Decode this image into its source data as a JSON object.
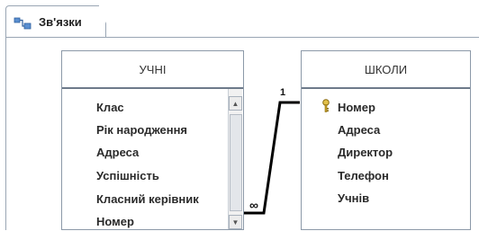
{
  "tab": {
    "label": "Зв'язки",
    "icon": "relationships-icon"
  },
  "tables": {
    "students": {
      "title": "УЧНІ",
      "fields": [
        "Клас",
        "Рік народження",
        "Адреса",
        "Успішність",
        "Класний керівник",
        "Номер"
      ]
    },
    "schools": {
      "title": "ШКОЛИ",
      "fields": [
        "Номер",
        "Адреса",
        "Директор",
        "Телефон",
        "Учнів"
      ],
      "primary_key": "Номер"
    }
  },
  "relationship": {
    "one_label": "1",
    "many_label": "∞"
  },
  "colors": {
    "border": "#8c99a8",
    "key": "#c9a227",
    "line": "#000000"
  }
}
